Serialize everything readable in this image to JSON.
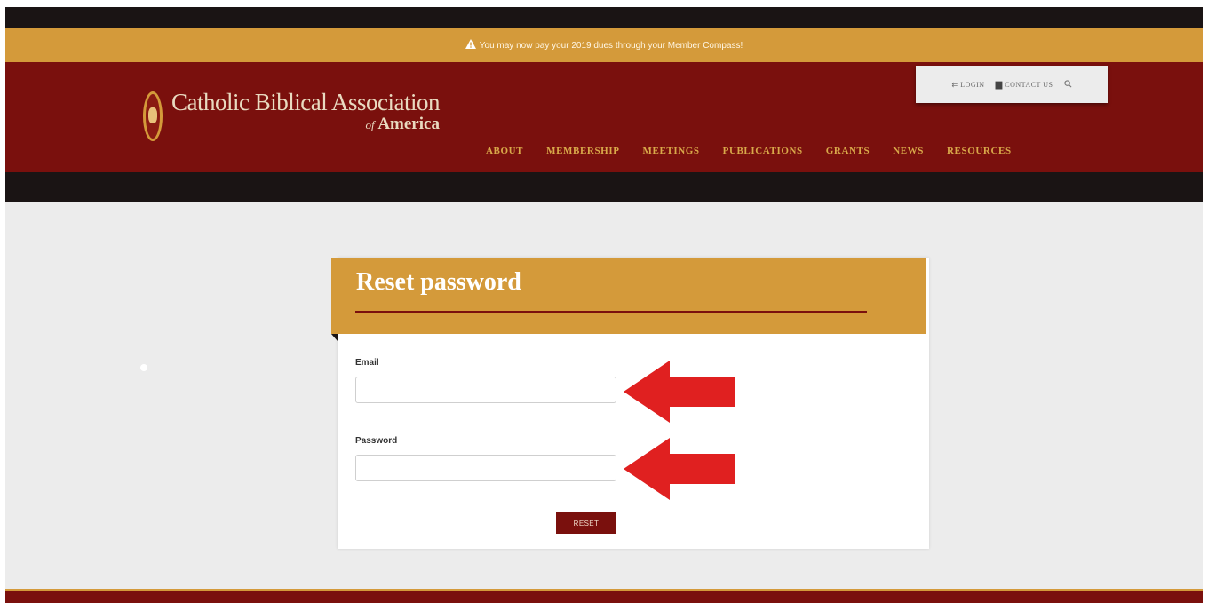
{
  "notice": {
    "icon": "warning-icon",
    "text": "You may now pay your 2019 dues through your Member Compass!"
  },
  "logo": {
    "main": "Catholic Biblical Association",
    "sub_of": "of",
    "sub_main": "America"
  },
  "utility": {
    "login": "LOGIN",
    "contact": "CONTACT US",
    "login_icon": "login-arrow-icon",
    "contact_icon": "printer-icon",
    "search_icon": "search-icon"
  },
  "nav": [
    "ABOUT",
    "MEMBERSHIP",
    "MEETINGS",
    "PUBLICATIONS",
    "GRANTS",
    "NEWS",
    "RESOURCES"
  ],
  "form": {
    "title": "Reset password",
    "email_label": "Email",
    "email_value": "",
    "password_label": "Password",
    "password_value": "",
    "reset_label": "RESET"
  },
  "colors": {
    "maroon": "#7a100d",
    "gold": "#d49a3a",
    "black": "#1a1414",
    "arrow_red": "#e02020"
  }
}
